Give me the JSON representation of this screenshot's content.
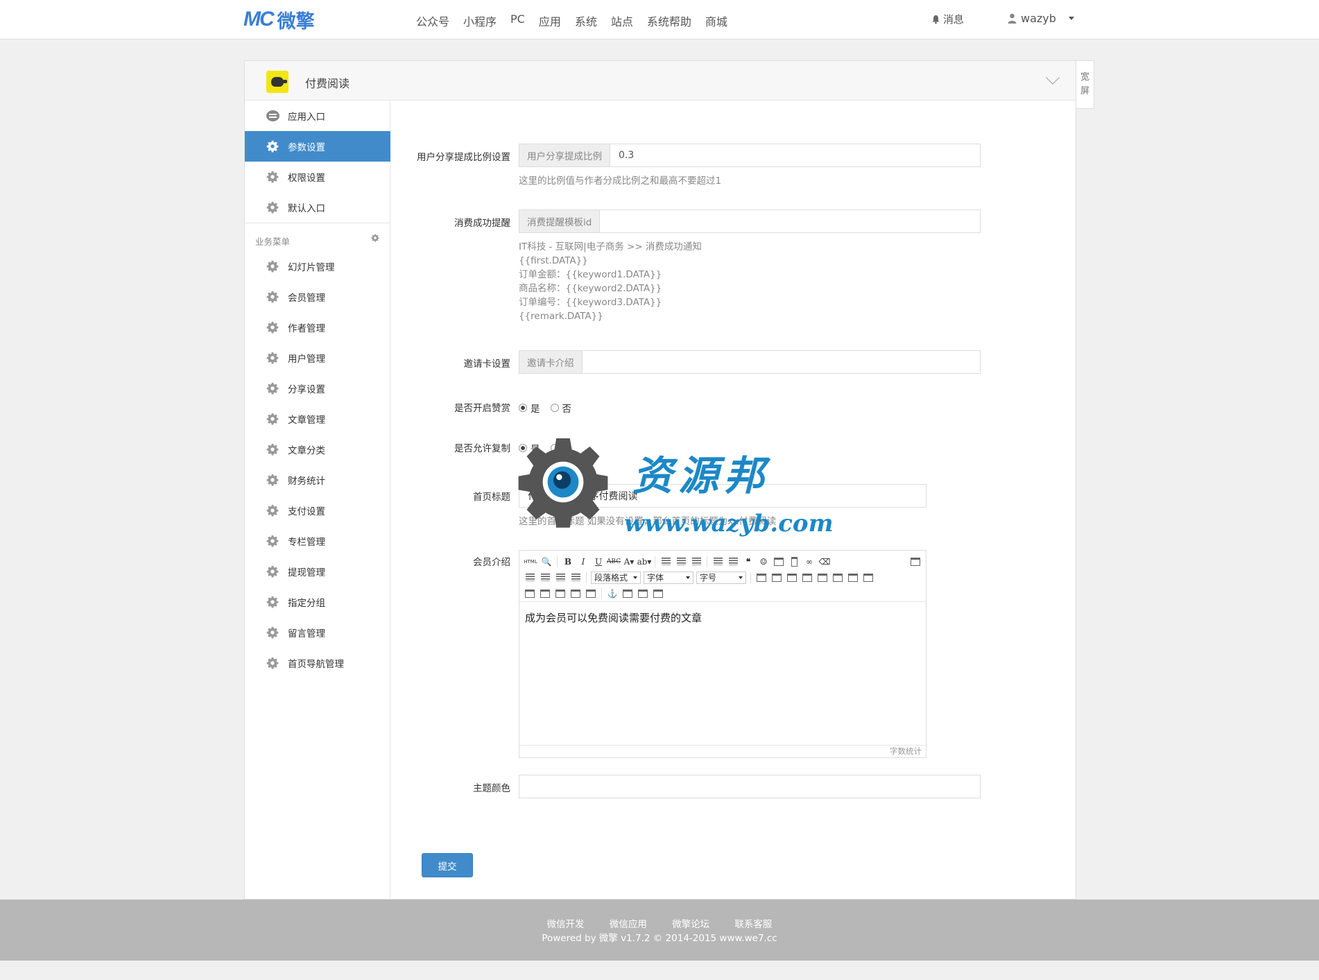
{
  "header": {
    "logo_mark": "MC",
    "logo_text": "微擎",
    "nav": [
      "公众号",
      "小程序",
      "PC",
      "应用",
      "系统",
      "站点",
      "系统帮助",
      "商城"
    ],
    "messages_label": "消息",
    "username": "wazyb"
  },
  "panel": {
    "app_title": "付费阅读",
    "wide_label_1": "宽",
    "wide_label_2": "屏"
  },
  "sidebar": {
    "top_items": [
      {
        "label": "应用入口",
        "icon": "comment-icon",
        "active": false
      },
      {
        "label": "参数设置",
        "icon": "gear-icon",
        "active": true
      },
      {
        "label": "权限设置",
        "icon": "gear-icon",
        "active": false
      },
      {
        "label": "默认入口",
        "icon": "gear-icon",
        "active": false
      }
    ],
    "group_title": "业务菜单",
    "menu_items": [
      "幻灯片管理",
      "会员管理",
      "作者管理",
      "用户管理",
      "分享设置",
      "文章管理",
      "文章分类",
      "财务统计",
      "支付设置",
      "专栏管理",
      "提现管理",
      "指定分组",
      "留言管理",
      "首页导航管理"
    ]
  },
  "form": {
    "share_ratio": {
      "label": "用户分享提成比例设置",
      "addon": "用户分享提成比例",
      "value": "0.3",
      "help": "这里的比例值与作者分成比例之和最高不要超过1"
    },
    "consume_notice": {
      "label": "消费成功提醒",
      "addon": "消费提醒模板id",
      "value": "",
      "help_lines": [
        "IT科技 - 互联网|电子商务 >> 消费成功通知",
        "{{first.DATA}}",
        "订单金额：{{keyword1.DATA}}",
        "商品名称：{{keyword2.DATA}}",
        "订单编号：{{keyword3.DATA}}",
        "{{remark.DATA}}"
      ]
    },
    "invite_card": {
      "label": "邀请卡设置",
      "addon": "邀请卡介绍",
      "value": ""
    },
    "reward": {
      "label": "是否开启赞赏",
      "yes": "是",
      "no": "否",
      "selected": "yes"
    },
    "copy": {
      "label": "是否允许复制",
      "yes": "是",
      "no": "否",
      "selected": "yes"
    },
    "home_title": {
      "label": "首页标题",
      "value": "付费阅读 小程序付费阅读",
      "help": "这里的首页标题 如果没有设置，那么首页的标题为xx付费阅读"
    },
    "member_intro": {
      "label": "会员介绍",
      "toolbar_paragraph": "段落格式",
      "toolbar_font": "字体",
      "toolbar_size": "字号",
      "html_btn": "HTML",
      "content": "成为会员可以免费阅读需要付费的文章",
      "word_count": "字数统计"
    },
    "theme_color": {
      "label": "主题颜色",
      "value": ""
    },
    "submit_label": "提交"
  },
  "watermark": {
    "text": "资源邦",
    "url": "www.wazyb.com"
  },
  "footer": {
    "links": [
      "微信开发",
      "微信应用",
      "微擎论坛",
      "联系客服"
    ],
    "copyright": "Powered by 微擎 v1.7.2 © 2014-2015 www.we7.cc"
  },
  "colors": {
    "accent": "#428bca",
    "logo": "#3a7fd5",
    "footer_bg": "#b7b7b7",
    "watermark": "#1d88c7"
  }
}
